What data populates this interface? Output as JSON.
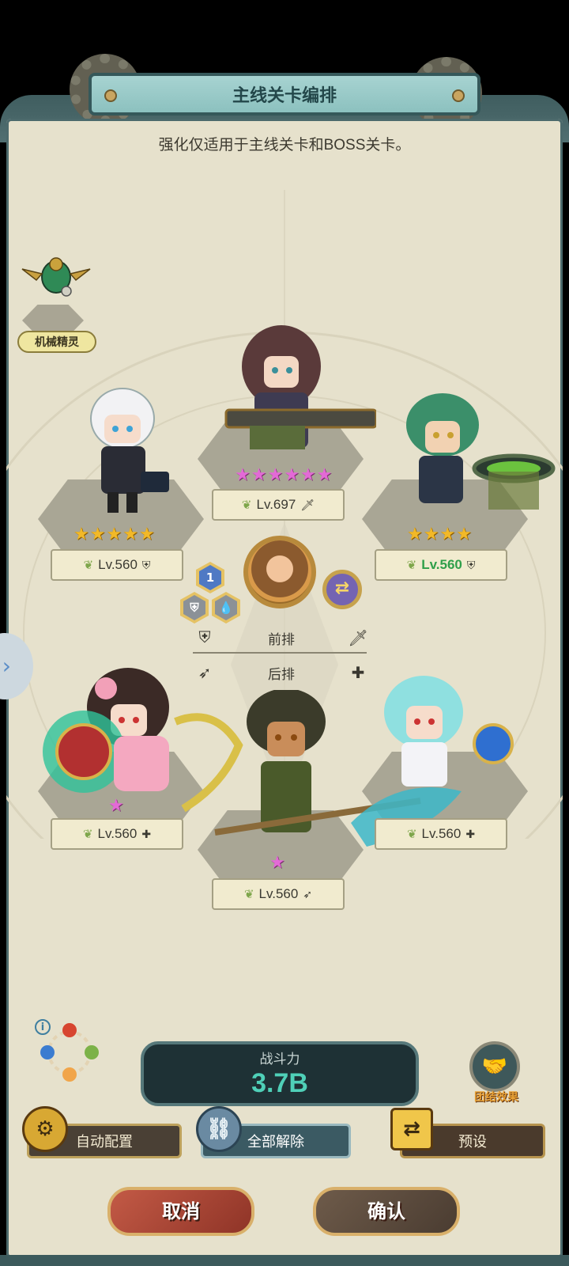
{
  "header": {
    "title": "主线关卡编排",
    "subtitle": "强化仅适用于主线关卡和BOSS关卡。"
  },
  "spirit": {
    "label": "机械精灵",
    "icon": "mechanical-beetle-icon"
  },
  "heroes": [
    {
      "slot": "front-left",
      "stars": 5,
      "star_color": "gold",
      "level": "Lv.560",
      "role_icon": "shield-icon",
      "level_color": "#3b3a32"
    },
    {
      "slot": "front-center",
      "stars": 6,
      "star_color": "pink",
      "level": "Lv.697",
      "role_icon": "sword-icon",
      "level_color": "#3b3a32"
    },
    {
      "slot": "front-right",
      "stars": 4,
      "star_color": "gold",
      "level": "Lv.560",
      "role_icon": "shield-icon",
      "level_color": "#2f9f4a"
    },
    {
      "slot": "back-left",
      "stars": 1,
      "star_color": "pink",
      "level": "Lv.560",
      "role_icon": "cross-icon",
      "level_color": "#3b3a32"
    },
    {
      "slot": "back-center",
      "stars": 1,
      "star_color": "pink",
      "level": "Lv.560",
      "role_icon": "bow-icon",
      "level_color": "#3b3a32"
    },
    {
      "slot": "back-right",
      "stars": 0,
      "star_color": "pink",
      "level": "Lv.560",
      "role_icon": "cross-icon",
      "level_color": "#3b3a32"
    }
  ],
  "leader": {
    "badge_number": "1"
  },
  "legend": {
    "front_label": "前排",
    "back_label": "后排",
    "front_left_icon": "shield-icon",
    "front_right_icon": "sword-icon",
    "back_left_icon": "bow-icon",
    "back_right_icon": "cross-icon"
  },
  "power": {
    "label": "战斗力",
    "value": "3.7B"
  },
  "bond": {
    "label": "团结效果"
  },
  "buttons": {
    "auto": "自动配置",
    "clear": "全部解除",
    "preset": "预设",
    "cancel": "取消",
    "confirm": "确认"
  },
  "colors": {
    "panel": "#e6e1cc",
    "frame": "#3f5d5f",
    "power_value": "#4fd0b8",
    "gold_star": "#f2b928",
    "pink_star": "#e36ad6"
  }
}
